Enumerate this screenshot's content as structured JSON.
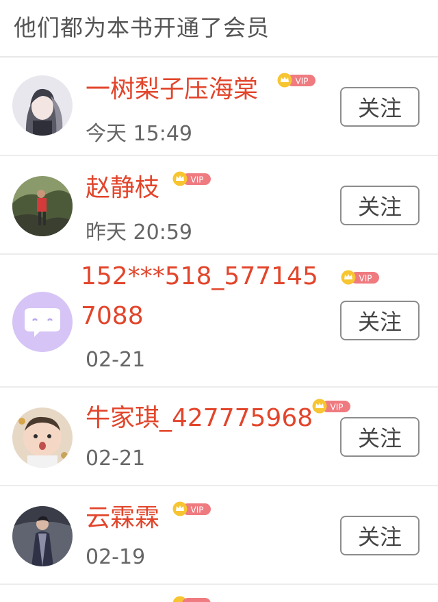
{
  "header": {
    "title": "他们都为本书开通了会员"
  },
  "vip_badge": {
    "label": "VIP",
    "gold": "#f7c531",
    "pink": "#ef7b80"
  },
  "follow_label": "关注",
  "members": [
    {
      "name": "一树梨子压海棠",
      "time": "今天 15:49",
      "avatar": "girl-illustration-avatar"
    },
    {
      "name": "赵静枝",
      "time": "昨天 20:59",
      "avatar": "outdoor-photo-avatar"
    },
    {
      "name": "152***518_5771457088",
      "time": "02-21",
      "avatar": "chat-bubble-avatar"
    },
    {
      "name": "牛家琪_427775968",
      "time": "02-21",
      "avatar": "baby-photo-avatar"
    },
    {
      "name": "云霖霖",
      "time": "02-19",
      "avatar": "costume-photo-avatar"
    }
  ],
  "colors": {
    "name": "#e2452b",
    "time": "#666666",
    "divider": "#ececec"
  }
}
